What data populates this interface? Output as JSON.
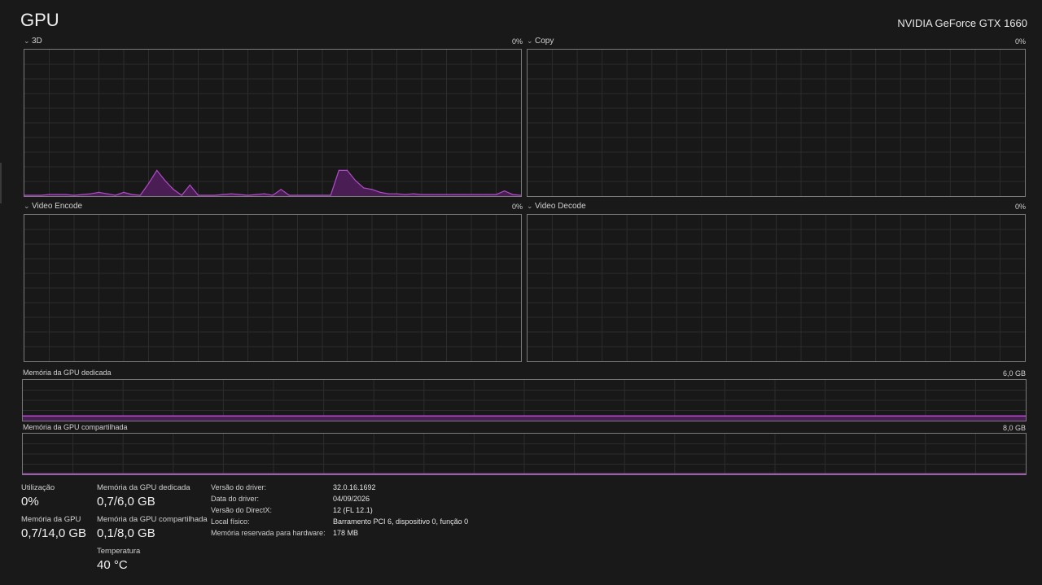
{
  "header": {
    "title": "GPU",
    "device_name": "NVIDIA GeForce GTX 1660"
  },
  "engines": [
    {
      "label": "3D",
      "value": "0%",
      "chart_data": {
        "type": "area",
        "x": [
          0,
          1,
          2,
          3,
          4,
          5,
          6,
          7,
          8,
          9,
          10,
          11,
          12,
          13,
          14,
          15,
          16,
          17,
          18,
          19,
          20,
          21,
          22,
          23,
          24,
          25,
          26,
          27,
          28,
          29,
          30,
          31,
          32,
          33,
          34,
          35,
          36,
          37,
          38,
          39,
          40,
          41,
          42,
          43,
          44,
          45,
          46,
          47,
          48,
          49,
          50,
          51,
          52,
          53,
          54,
          55,
          56,
          57,
          58,
          59,
          60
        ],
        "values": [
          0,
          0,
          0,
          0.5,
          0.5,
          0.5,
          0,
          0.5,
          1,
          2,
          1,
          0,
          2,
          0.5,
          0,
          8,
          17,
          10,
          4,
          0,
          7,
          0,
          0,
          0,
          0.5,
          1,
          0.5,
          0,
          0.5,
          1,
          0,
          4,
          0,
          0,
          0,
          0,
          0,
          0,
          17,
          17,
          10,
          5,
          4,
          2,
          1,
          1,
          0.5,
          1,
          0.5,
          0.5,
          0.5,
          0.5,
          0.5,
          0.5,
          0.5,
          0.5,
          0.5,
          0.5,
          3,
          0.5,
          0
        ],
        "ylim": [
          0,
          100
        ]
      }
    },
    {
      "label": "Copy",
      "value": "0%",
      "chart_data": {
        "type": "area",
        "values": [],
        "ylim": [
          0,
          100
        ]
      }
    },
    {
      "label": "Video Encode",
      "value": "0%",
      "chart_data": {
        "type": "area",
        "values": [],
        "ylim": [
          0,
          100
        ]
      }
    },
    {
      "label": "Video Decode",
      "value": "0%",
      "chart_data": {
        "type": "area",
        "values": [],
        "ylim": [
          0,
          100
        ]
      }
    }
  ],
  "memory_graphs": [
    {
      "label": "Memória da GPU dedicada",
      "max": "6,0 GB",
      "chart_data": {
        "type": "area",
        "level_gb": 0.7,
        "ylim": [
          0,
          6.0
        ]
      }
    },
    {
      "label": "Memória da GPU compartilhada",
      "max": "8,0 GB",
      "chart_data": {
        "type": "area",
        "level_gb": 0.1,
        "ylim": [
          0,
          8.0
        ]
      }
    }
  ],
  "stats": {
    "utilization": {
      "label": "Utilização",
      "value": "0%"
    },
    "gpu_memory": {
      "label": "Memória da GPU",
      "value": "0,7/14,0 GB"
    },
    "dedicated": {
      "label": "Memória da GPU dedicada",
      "value": "0,7/6,0 GB"
    },
    "shared": {
      "label": "Memória da GPU compartilhada",
      "value": "0,1/8,0 GB"
    },
    "temperature": {
      "label": "Temperatura",
      "value": "40 °C"
    }
  },
  "info": [
    {
      "label": "Versão do driver:",
      "value": "32.0.16.1692"
    },
    {
      "label": "Data do driver:",
      "value": "04/09/2026"
    },
    {
      "label": "Versão do DirectX:",
      "value": "12 (FL 12.1)"
    },
    {
      "label": "Local físico:",
      "value": "Barramento PCI 6, dispositivo 0, função 0"
    },
    {
      "label": "Memória reservada para hardware:",
      "value": "178 MB"
    }
  ],
  "colors": {
    "accent_line": "#b04cc8",
    "accent_fill": "#4b1d55",
    "grid": "#2c2c2c",
    "border": "#7a7a7a"
  }
}
